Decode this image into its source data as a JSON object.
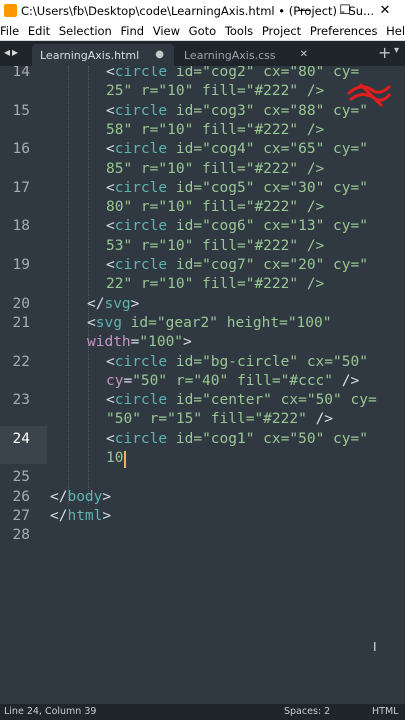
{
  "window": {
    "title": "C:\\Users\\fb\\Desktop\\code\\LearningAxis.html • (Project) - Su...",
    "minimize": "—",
    "maximize": "☐",
    "close": "✕"
  },
  "menu": [
    "File",
    "Edit",
    "Selection",
    "Find",
    "View",
    "Goto",
    "Tools",
    "Project",
    "Preferences",
    "Help"
  ],
  "tabs": [
    {
      "label": "LearningAxis.html",
      "mark": "●"
    },
    {
      "label": "LearningAxis.css",
      "mark": "✕"
    }
  ],
  "tabbar": {
    "nav": "◂▸",
    "plus": "+",
    "more": "▾"
  },
  "editor": {
    "lines": [
      {
        "no": "14",
        "segs": [
          {
            "t": "<circle id=\"cog2\" cx=\"80\" cy=",
            "k": "x"
          }
        ]
      },
      {
        "no": "",
        "segs": [
          {
            "t": "25\" r=\"10\" fill=\"#222\" />",
            "k": "x"
          }
        ]
      },
      {
        "no": "15",
        "segs": [
          {
            "t": "<circle id=\"cog3\" cx=\"88\" cy=\"",
            "k": "x"
          }
        ]
      },
      {
        "no": "",
        "segs": [
          {
            "t": "58\" r=\"10\" fill=\"#222\" />",
            "k": "x"
          }
        ]
      },
      {
        "no": "16",
        "segs": [
          {
            "t": "<circle id=\"cog4\" cx=\"65\" cy=\"",
            "k": "x"
          }
        ]
      },
      {
        "no": "",
        "segs": [
          {
            "t": "85\" r=\"10\" fill=\"#222\" />",
            "k": "x"
          }
        ]
      },
      {
        "no": "17",
        "segs": [
          {
            "t": "<circle id=\"cog5\" cx=\"30\" cy=\"",
            "k": "x"
          }
        ]
      },
      {
        "no": "",
        "segs": [
          {
            "t": "80\" r=\"10\" fill=\"#222\" />",
            "k": "x"
          }
        ]
      },
      {
        "no": "18",
        "segs": [
          {
            "t": "<circle id=\"cog6\" cx=\"13\" cy=\"",
            "k": "x"
          }
        ]
      },
      {
        "no": "",
        "segs": [
          {
            "t": "53\" r=\"10\" fill=\"#222\" />",
            "k": "x"
          }
        ]
      },
      {
        "no": "19",
        "segs": [
          {
            "t": "<circle id=\"cog7\" cx=\"20\" cy=\"",
            "k": "x"
          }
        ]
      },
      {
        "no": "",
        "segs": [
          {
            "t": "22\" r=\"10\" fill=\"#222\" />",
            "k": "x"
          }
        ]
      },
      {
        "no": "20",
        "segs": [
          {
            "t": "</svg>",
            "k": "x"
          }
        ]
      },
      {
        "no": "21",
        "segs": [
          {
            "t": "<svg id=\"gear2\" height=\"100\"",
            "k": "x"
          }
        ]
      },
      {
        "no": "",
        "segs": [
          {
            "t": "width=\"100\">",
            "k": "x"
          }
        ]
      },
      {
        "no": "22",
        "segs": [
          {
            "t": "<circle id=\"bg-circle\" cx=\"50\"",
            "k": "x"
          }
        ]
      },
      {
        "no": "",
        "segs": [
          {
            "t": "cy=\"50\" r=\"40\" fill=\"#ccc\" />",
            "k": "x"
          }
        ]
      },
      {
        "no": "23",
        "segs": [
          {
            "t": "<circle id=\"center\" cx=\"50\" cy=",
            "k": "x"
          }
        ]
      },
      {
        "no": "",
        "segs": [
          {
            "t": "\"50\" r=\"15\" fill=\"#222\" />",
            "k": "x"
          }
        ]
      },
      {
        "no": "24",
        "segs": [
          {
            "t": "<circle id=\"cog1\" cx=\"50\" cy=\"",
            "k": "x"
          }
        ]
      },
      {
        "no": "",
        "segs": [
          {
            "t": "10",
            "k": "x"
          }
        ]
      },
      {
        "no": "25",
        "segs": []
      },
      {
        "no": "26",
        "segs": [
          {
            "t": "</body>",
            "k": "x"
          }
        ]
      },
      {
        "no": "27",
        "segs": [
          {
            "t": "</html>",
            "k": "x"
          }
        ]
      },
      {
        "no": "28",
        "segs": []
      }
    ]
  },
  "status": {
    "position": "Line 24, Column 39",
    "spaces": "Spaces: 2",
    "syntax": "HTML"
  },
  "colors": {
    "background": "#303841",
    "tag": "#5fb3b3",
    "attr": "#c594c5",
    "string": "#99c794",
    "punct": "#d8dee9",
    "cursor": "#f9ae58",
    "mark": "#e01e1e"
  }
}
